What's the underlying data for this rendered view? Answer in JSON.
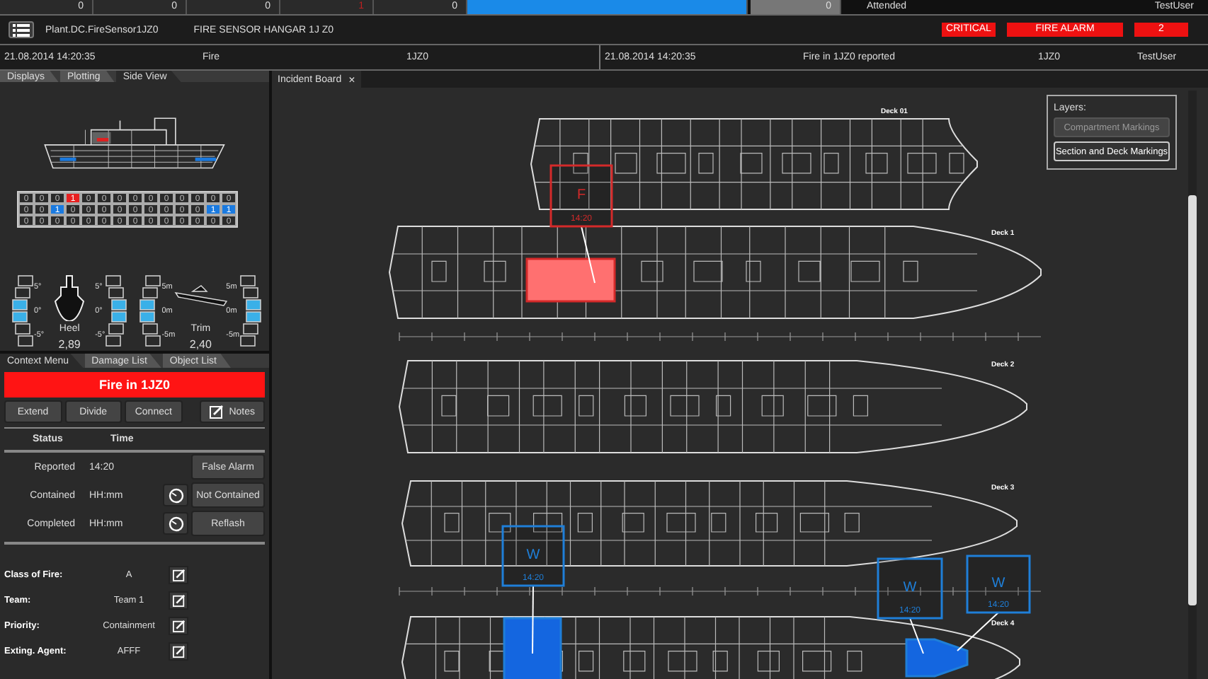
{
  "counters": [
    {
      "value": "0",
      "kind": "plain"
    },
    {
      "value": "0",
      "kind": "plain"
    },
    {
      "value": "0",
      "kind": "plain"
    },
    {
      "value": "1",
      "kind": "alert"
    },
    {
      "value": "0",
      "kind": "plain"
    },
    {
      "kind": "bar"
    },
    {
      "value": "0",
      "kind": "muted"
    }
  ],
  "status": {
    "state": "Attended",
    "user": "TestUser"
  },
  "alarm_bar": {
    "source": "Plant.DC.FireSensor1JZ0",
    "title": "FIRE SENSOR HANGAR 1J Z0",
    "badges": [
      "CRITICAL",
      "FIRE ALARM",
      "2"
    ]
  },
  "event_left": {
    "time": "21.08.2014 14:20:35",
    "type": "Fire",
    "zone": "1JZ0"
  },
  "event_right": {
    "time": "21.08.2014 14:20:35",
    "message": "Fire in 1JZ0 reported",
    "zone": "1JZ0",
    "user": "TestUser"
  },
  "top_tabs": [
    {
      "label": "Displays",
      "selected": false
    },
    {
      "label": "Plotting",
      "selected": false
    },
    {
      "label": "Side View",
      "selected": true
    }
  ],
  "grid": [
    [
      {
        "value": "0",
        "kind": "normal"
      },
      {
        "value": "0",
        "kind": "normal"
      },
      {
        "value": "0",
        "kind": "normal"
      },
      {
        "value": "1",
        "kind": "fire"
      },
      {
        "value": "0",
        "kind": "normal"
      },
      {
        "value": "0",
        "kind": "normal"
      },
      {
        "value": "0",
        "kind": "normal"
      },
      {
        "value": "0",
        "kind": "normal"
      },
      {
        "value": "0",
        "kind": "normal"
      },
      {
        "value": "0",
        "kind": "normal"
      },
      {
        "value": "0",
        "kind": "normal"
      },
      {
        "value": "0",
        "kind": "normal"
      },
      {
        "value": "0",
        "kind": "normal"
      },
      {
        "value": "0",
        "kind": "normal"
      }
    ],
    [
      {
        "value": "0",
        "kind": "normal"
      },
      {
        "value": "0",
        "kind": "normal"
      },
      {
        "value": "1",
        "kind": "water"
      },
      {
        "value": "0",
        "kind": "normal"
      },
      {
        "value": "0",
        "kind": "normal"
      },
      {
        "value": "0",
        "kind": "normal"
      },
      {
        "value": "0",
        "kind": "normal"
      },
      {
        "value": "0",
        "kind": "normal"
      },
      {
        "value": "0",
        "kind": "normal"
      },
      {
        "value": "0",
        "kind": "normal"
      },
      {
        "value": "0",
        "kind": "normal"
      },
      {
        "value": "0",
        "kind": "normal"
      },
      {
        "value": "1",
        "kind": "water"
      },
      {
        "value": "1",
        "kind": "water"
      }
    ],
    [
      {
        "value": "0",
        "kind": "normal"
      },
      {
        "value": "0",
        "kind": "normal"
      },
      {
        "value": "0",
        "kind": "normal"
      },
      {
        "value": "0",
        "kind": "normal"
      },
      {
        "value": "0",
        "kind": "normal"
      },
      {
        "value": "0",
        "kind": "normal"
      },
      {
        "value": "0",
        "kind": "normal"
      },
      {
        "value": "0",
        "kind": "normal"
      },
      {
        "value": "0",
        "kind": "normal"
      },
      {
        "value": "0",
        "kind": "normal"
      },
      {
        "value": "0",
        "kind": "normal"
      },
      {
        "value": "0",
        "kind": "normal"
      },
      {
        "value": "0",
        "kind": "normal"
      },
      {
        "value": "0",
        "kind": "normal"
      }
    ]
  ],
  "gauges": [
    {
      "kind": "heel",
      "name": "Heel",
      "reading": "2,89",
      "ticks_left": [
        "5°",
        "0°",
        "-5°"
      ],
      "ticks_right": [
        "5°",
        "0°",
        "-5°"
      ]
    },
    {
      "kind": "trim",
      "name": "Trim",
      "reading": "2,40",
      "ticks_left": [
        "5m",
        "0m",
        "-5m"
      ],
      "ticks_right": [
        "5m",
        "0m",
        "-5m"
      ]
    }
  ],
  "bottom_tabs": [
    {
      "label": "Context Menu",
      "selected": true
    },
    {
      "label": "Damage List",
      "selected": false
    },
    {
      "label": "Object List",
      "selected": false
    }
  ],
  "incident": {
    "title": "Fire in 1JZ0",
    "actions": [
      "Extend",
      "Divide",
      "Connect"
    ],
    "notes": "Notes",
    "columns": [
      "Status",
      "Time"
    ],
    "rows": [
      {
        "status": "Reported",
        "time": "14:20",
        "timer": false,
        "action": "False Alarm"
      },
      {
        "status": "Contained",
        "time": "HH:mm",
        "timer": true,
        "action": "Not Contained"
      },
      {
        "status": "Completed",
        "time": "HH:mm",
        "timer": true,
        "action": "Reflash"
      }
    ],
    "properties": [
      {
        "label": "Class of Fire:",
        "value": "A"
      },
      {
        "label": "Team:",
        "value": "Team 1"
      },
      {
        "label": "Priority:",
        "value": "Containment"
      },
      {
        "label": "Exting. Agent:",
        "value": "AFFF"
      }
    ]
  },
  "board": {
    "tab": "Incident Board",
    "close": "×",
    "layers": {
      "title": "Layers:",
      "buttons": [
        {
          "label": "Compartment Markings",
          "selected": false
        },
        {
          "label": "Section and Deck Markings",
          "selected": true
        }
      ]
    },
    "decks": [
      "Deck 01",
      "Deck 1",
      "Deck 2",
      "Deck 3",
      "Deck 4"
    ],
    "markers": [
      {
        "kind": "fire",
        "letter": "F",
        "time": "14:20"
      },
      {
        "kind": "water",
        "letter": "W",
        "time": "14:20"
      },
      {
        "kind": "water",
        "letter": "W",
        "time": "14:20"
      },
      {
        "kind": "water",
        "letter": "W",
        "time": "14:20"
      }
    ]
  }
}
